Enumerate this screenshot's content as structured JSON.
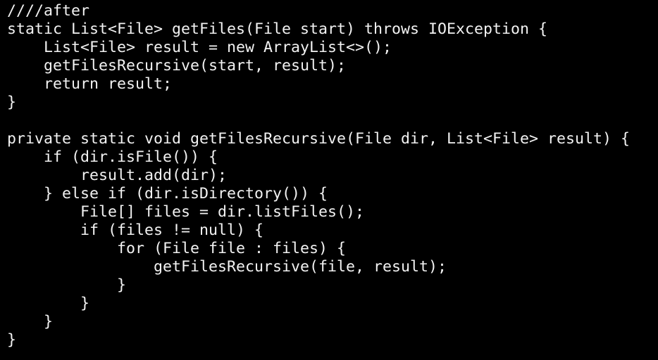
{
  "code": {
    "lines": [
      "////after",
      "static List<File> getFiles(File start) throws IOException {",
      "    List<File> result = new ArrayList<>();",
      "    getFilesRecursive(start, result);",
      "    return result;",
      "}",
      "",
      "private static void getFilesRecursive(File dir, List<File> result) {",
      "    if (dir.isFile()) {",
      "        result.add(dir);",
      "    } else if (dir.isDirectory()) {",
      "        File[] files = dir.listFiles();",
      "        if (files != null) {",
      "            for (File file : files) {",
      "                getFilesRecursive(file, result);",
      "            }",
      "        }",
      "    }",
      "}"
    ]
  },
  "colors": {
    "background": "#000000",
    "text": "#f2f2f2"
  }
}
